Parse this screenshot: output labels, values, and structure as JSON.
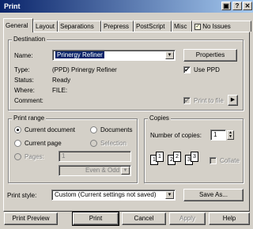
{
  "window": {
    "title": "Print"
  },
  "titlebar_buttons": [
    "?",
    "✕"
  ],
  "tabs": [
    {
      "label": "General"
    },
    {
      "label": "Layout"
    },
    {
      "label": "Separations"
    },
    {
      "label": "Prepress"
    },
    {
      "label": "PostScript"
    },
    {
      "label": "Misc"
    },
    {
      "label": "No Issues"
    }
  ],
  "destination": {
    "group_label": "Destination",
    "name_label": "Name:",
    "name_value": "Prinergy Refiner",
    "properties_button": "Properties",
    "type_label": "Type:",
    "type_value": "(PPD) Prinergy Refiner",
    "status_label": "Status:",
    "status_value": "Ready",
    "where_label": "Where:",
    "where_value": "FILE:",
    "comment_label": "Comment:",
    "use_ppd_label": "Use PPD",
    "print_to_file_label": "Print to file"
  },
  "print_range": {
    "group_label": "Print range",
    "current_document": "Current document",
    "documents": "Documents",
    "current_page": "Current page",
    "selection": "Selection",
    "pages_label": "Pages:",
    "pages_value": "1",
    "even_odd": "Even & Odd"
  },
  "copies": {
    "group_label": "Copies",
    "number_label": "Number of copies:",
    "number_value": "1",
    "collate_label": "Collate",
    "page_digits": [
      "1",
      "1",
      "2",
      "2",
      "3",
      "3"
    ]
  },
  "print_style": {
    "label": "Print style:",
    "value": "Custom (Current settings not saved)",
    "save_as_button": "Save As..."
  },
  "buttons": {
    "preview": "Print Preview",
    "print": "Print",
    "cancel": "Cancel",
    "apply": "Apply",
    "help": "Help"
  }
}
